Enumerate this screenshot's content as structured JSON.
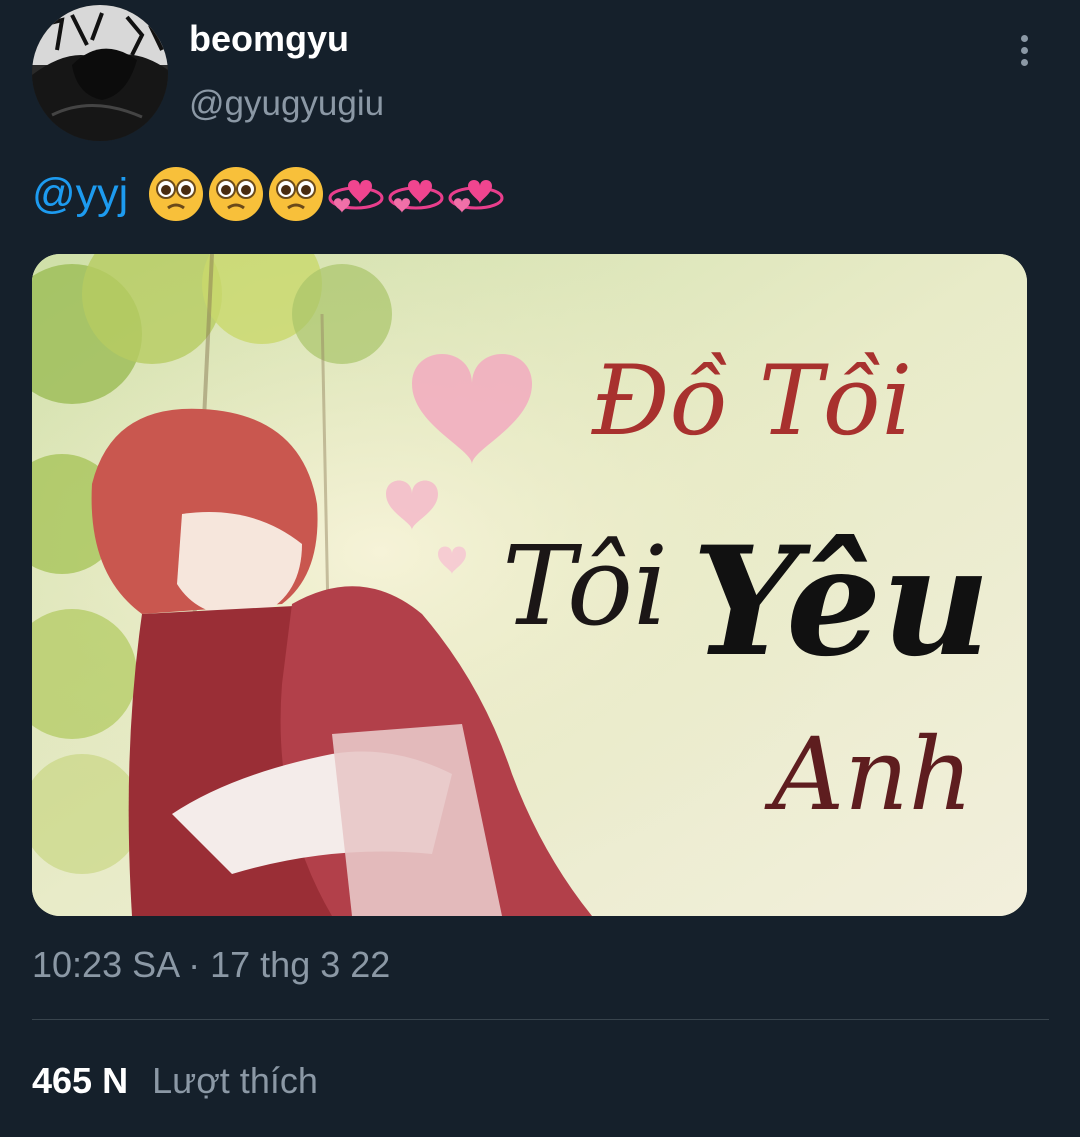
{
  "tweet": {
    "author": {
      "display_name": "beomgyu",
      "handle": "@gyugyugiu",
      "avatar_icon": "avatar-photo-icon"
    },
    "menu_icon": "more-options-icon",
    "text": {
      "mention": "@yyj",
      "emojis": [
        "pleading-face",
        "pleading-face",
        "pleading-face",
        "revolving-hearts",
        "revolving-hearts",
        "revolving-hearts"
      ]
    },
    "media": {
      "overlay_lines": [
        "Đồ Tồi",
        "Tôi",
        "Yêu",
        "Anh"
      ]
    },
    "timestamp": "10:23 SA · 17 thg 3 22",
    "stats": {
      "likes_count": "465 N",
      "likes_label": "Lượt thích"
    }
  },
  "colors": {
    "background": "#15202b",
    "link": "#1d9bf0",
    "secondary_text": "#8b98a5",
    "divider": "#38444d"
  }
}
